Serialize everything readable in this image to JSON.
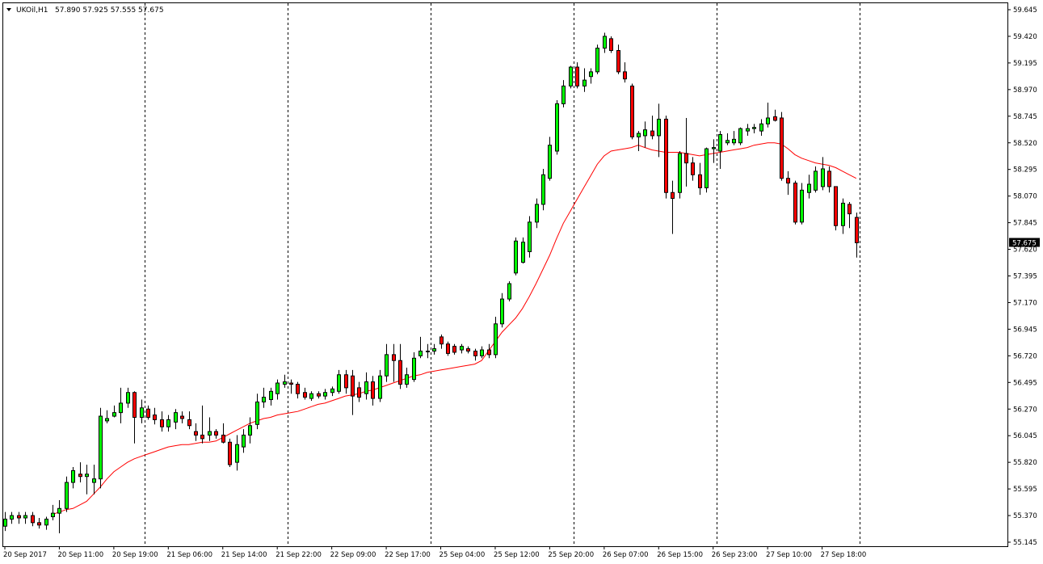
{
  "header": {
    "symbol_label": "UKOil,H1",
    "ohlc_label": "57.890 57.925 57.555 57.675"
  },
  "colors": {
    "background": "#ffffff",
    "bull_candle": "#00ff00",
    "bear_candle": "#ff0000",
    "wick": "#000000",
    "moving_average": "#ff0000",
    "badge_bg": "#000000",
    "badge_text": "#ffffff",
    "grid": "#000000"
  },
  "current_price": {
    "label": "57.675",
    "value": 57.675
  },
  "chart_data": {
    "type": "candlestick",
    "symbol": "UKOil",
    "timeframe": "H1",
    "grid": "vertical dashed separators at x tick positions",
    "ylim": [
      55.145,
      59.645
    ],
    "y_ticks": [
      "59.645",
      "59.420",
      "59.195",
      "58.970",
      "58.745",
      "58.520",
      "58.295",
      "58.070",
      "57.845",
      "57.620",
      "57.395",
      "57.170",
      "56.945",
      "56.720",
      "56.495",
      "56.270",
      "56.045",
      "55.820",
      "55.595",
      "55.370",
      "55.145"
    ],
    "x_ticks": [
      "20 Sep 2017",
      "20 Sep 11:00",
      "20 Sep 19:00",
      "21 Sep 06:00",
      "21 Sep 14:00",
      "21 Sep 22:00",
      "22 Sep 09:00",
      "22 Sep 17:00",
      "25 Sep 04:00",
      "25 Sep 12:00",
      "25 Sep 20:00",
      "26 Sep 07:00",
      "26 Sep 15:00",
      "26 Sep 23:00",
      "27 Sep 10:00",
      "27 Sep 18:00"
    ],
    "x_tick_bar_index": [
      0,
      8,
      16,
      24,
      32,
      40,
      48,
      56,
      64,
      72,
      80,
      88,
      96,
      104,
      112,
      120
    ],
    "separator_bar_index": [
      20.5,
      41.5,
      62.5,
      83.5,
      104.5,
      125.5
    ],
    "candles": [
      {
        "o": 55.28,
        "h": 55.4,
        "l": 55.24,
        "c": 55.34
      },
      {
        "o": 55.34,
        "h": 55.4,
        "l": 55.3,
        "c": 55.37
      },
      {
        "o": 55.37,
        "h": 55.4,
        "l": 55.3,
        "c": 55.35
      },
      {
        "o": 55.35,
        "h": 55.4,
        "l": 55.3,
        "c": 55.37
      },
      {
        "o": 55.37,
        "h": 55.4,
        "l": 55.28,
        "c": 55.31
      },
      {
        "o": 55.31,
        "h": 55.35,
        "l": 55.26,
        "c": 55.29
      },
      {
        "o": 55.29,
        "h": 55.36,
        "l": 55.25,
        "c": 55.34
      },
      {
        "o": 55.36,
        "h": 55.46,
        "l": 55.33,
        "c": 55.39
      },
      {
        "o": 55.39,
        "h": 55.5,
        "l": 55.22,
        "c": 55.43
      },
      {
        "o": 55.43,
        "h": 55.7,
        "l": 55.4,
        "c": 55.65
      },
      {
        "o": 55.65,
        "h": 55.78,
        "l": 55.6,
        "c": 55.75
      },
      {
        "o": 55.72,
        "h": 55.82,
        "l": 55.65,
        "c": 55.7
      },
      {
        "o": 55.7,
        "h": 55.8,
        "l": 55.55,
        "c": 55.72
      },
      {
        "o": 55.65,
        "h": 55.8,
        "l": 55.55,
        "c": 55.68
      },
      {
        "o": 55.68,
        "h": 56.28,
        "l": 55.6,
        "c": 56.21
      },
      {
        "o": 56.17,
        "h": 56.26,
        "l": 56.15,
        "c": 56.19
      },
      {
        "o": 56.21,
        "h": 56.3,
        "l": 56.2,
        "c": 56.24
      },
      {
        "o": 56.24,
        "h": 56.45,
        "l": 56.15,
        "c": 56.32
      },
      {
        "o": 56.32,
        "h": 56.45,
        "l": 56.28,
        "c": 56.41
      },
      {
        "o": 56.41,
        "h": 56.42,
        "l": 55.98,
        "c": 56.2
      },
      {
        "o": 56.2,
        "h": 56.35,
        "l": 56.15,
        "c": 56.28
      },
      {
        "o": 56.27,
        "h": 56.3,
        "l": 56.18,
        "c": 56.2
      },
      {
        "o": 56.22,
        "h": 56.28,
        "l": 56.14,
        "c": 56.18
      },
      {
        "o": 56.18,
        "h": 56.25,
        "l": 56.08,
        "c": 56.12
      },
      {
        "o": 56.12,
        "h": 56.22,
        "l": 56.08,
        "c": 56.18
      },
      {
        "o": 56.16,
        "h": 56.27,
        "l": 56.1,
        "c": 56.24
      },
      {
        "o": 56.21,
        "h": 56.25,
        "l": 56.15,
        "c": 56.19
      },
      {
        "o": 56.18,
        "h": 56.25,
        "l": 56.1,
        "c": 56.13
      },
      {
        "o": 56.08,
        "h": 56.15,
        "l": 56.0,
        "c": 56.05
      },
      {
        "o": 56.05,
        "h": 56.3,
        "l": 55.98,
        "c": 56.02
      },
      {
        "o": 56.05,
        "h": 56.2,
        "l": 56.0,
        "c": 56.08
      },
      {
        "o": 56.08,
        "h": 56.1,
        "l": 56.02,
        "c": 56.05
      },
      {
        "o": 56.05,
        "h": 56.15,
        "l": 55.98,
        "c": 55.99
      },
      {
        "o": 55.99,
        "h": 56.02,
        "l": 55.78,
        "c": 55.8
      },
      {
        "o": 55.82,
        "h": 56.05,
        "l": 55.75,
        "c": 55.97
      },
      {
        "o": 55.95,
        "h": 56.1,
        "l": 55.9,
        "c": 56.05
      },
      {
        "o": 56.05,
        "h": 56.2,
        "l": 55.98,
        "c": 56.13
      },
      {
        "o": 56.14,
        "h": 56.4,
        "l": 56.1,
        "c": 56.33
      },
      {
        "o": 56.33,
        "h": 56.45,
        "l": 56.28,
        "c": 56.37
      },
      {
        "o": 56.35,
        "h": 56.45,
        "l": 56.3,
        "c": 56.42
      },
      {
        "o": 56.4,
        "h": 56.52,
        "l": 56.35,
        "c": 56.49
      },
      {
        "o": 56.48,
        "h": 56.56,
        "l": 56.45,
        "c": 56.5
      },
      {
        "o": 56.49,
        "h": 56.52,
        "l": 56.4,
        "c": 56.48
      },
      {
        "o": 56.48,
        "h": 56.5,
        "l": 56.36,
        "c": 56.4
      },
      {
        "o": 56.41,
        "h": 56.45,
        "l": 56.35,
        "c": 56.37
      },
      {
        "o": 56.36,
        "h": 56.42,
        "l": 56.34,
        "c": 56.4
      },
      {
        "o": 56.4,
        "h": 56.42,
        "l": 56.36,
        "c": 56.38
      },
      {
        "o": 56.38,
        "h": 56.44,
        "l": 56.35,
        "c": 56.41
      },
      {
        "o": 56.41,
        "h": 56.46,
        "l": 56.38,
        "c": 56.44
      },
      {
        "o": 56.42,
        "h": 56.6,
        "l": 56.4,
        "c": 56.56
      },
      {
        "o": 56.56,
        "h": 56.6,
        "l": 56.4,
        "c": 56.45
      },
      {
        "o": 56.55,
        "h": 56.6,
        "l": 56.22,
        "c": 56.38
      },
      {
        "o": 56.45,
        "h": 56.5,
        "l": 56.33,
        "c": 56.37
      },
      {
        "o": 56.4,
        "h": 56.58,
        "l": 56.35,
        "c": 56.5
      },
      {
        "o": 56.5,
        "h": 56.55,
        "l": 56.3,
        "c": 56.36
      },
      {
        "o": 56.36,
        "h": 56.6,
        "l": 56.33,
        "c": 56.55
      },
      {
        "o": 56.55,
        "h": 56.82,
        "l": 56.5,
        "c": 56.73
      },
      {
        "o": 56.73,
        "h": 56.82,
        "l": 56.5,
        "c": 56.68
      },
      {
        "o": 56.68,
        "h": 56.82,
        "l": 56.44,
        "c": 56.48
      },
      {
        "o": 56.48,
        "h": 56.62,
        "l": 56.45,
        "c": 56.56
      },
      {
        "o": 56.52,
        "h": 56.75,
        "l": 56.5,
        "c": 56.7
      },
      {
        "o": 56.72,
        "h": 56.88,
        "l": 56.7,
        "c": 56.76
      },
      {
        "o": 56.76,
        "h": 56.82,
        "l": 56.7,
        "c": 56.76
      },
      {
        "o": 56.76,
        "h": 56.82,
        "l": 56.73,
        "c": 56.78
      },
      {
        "o": 56.88,
        "h": 56.9,
        "l": 56.78,
        "c": 56.82
      },
      {
        "o": 56.82,
        "h": 56.84,
        "l": 56.72,
        "c": 56.74
      },
      {
        "o": 56.8,
        "h": 56.82,
        "l": 56.73,
        "c": 56.75
      },
      {
        "o": 56.77,
        "h": 56.82,
        "l": 56.74,
        "c": 56.8
      },
      {
        "o": 56.78,
        "h": 56.8,
        "l": 56.74,
        "c": 56.76
      },
      {
        "o": 56.76,
        "h": 56.78,
        "l": 56.68,
        "c": 56.72
      },
      {
        "o": 56.72,
        "h": 56.8,
        "l": 56.7,
        "c": 56.77
      },
      {
        "o": 56.77,
        "h": 56.82,
        "l": 56.7,
        "c": 56.73
      },
      {
        "o": 56.73,
        "h": 57.05,
        "l": 56.7,
        "c": 56.99
      },
      {
        "o": 56.99,
        "h": 57.25,
        "l": 56.96,
        "c": 57.2
      },
      {
        "o": 57.2,
        "h": 57.35,
        "l": 57.18,
        "c": 57.33
      },
      {
        "o": 57.42,
        "h": 57.72,
        "l": 57.4,
        "c": 57.69
      },
      {
        "o": 57.51,
        "h": 57.72,
        "l": 57.5,
        "c": 57.68
      },
      {
        "o": 57.6,
        "h": 57.9,
        "l": 57.55,
        "c": 57.85
      },
      {
        "o": 57.85,
        "h": 58.05,
        "l": 57.8,
        "c": 58.0
      },
      {
        "o": 58.0,
        "h": 58.3,
        "l": 57.95,
        "c": 58.25
      },
      {
        "o": 58.22,
        "h": 58.57,
        "l": 58.2,
        "c": 58.5
      },
      {
        "o": 58.45,
        "h": 58.88,
        "l": 58.42,
        "c": 58.85
      },
      {
        "o": 58.85,
        "h": 59.05,
        "l": 58.82,
        "c": 59.0
      },
      {
        "o": 59.0,
        "h": 59.17,
        "l": 58.98,
        "c": 59.16
      },
      {
        "o": 59.16,
        "h": 59.2,
        "l": 58.98,
        "c": 59.0
      },
      {
        "o": 59.0,
        "h": 59.15,
        "l": 58.95,
        "c": 59.05
      },
      {
        "o": 59.08,
        "h": 59.15,
        "l": 59.02,
        "c": 59.12
      },
      {
        "o": 59.12,
        "h": 59.35,
        "l": 59.1,
        "c": 59.32
      },
      {
        "o": 59.32,
        "h": 59.45,
        "l": 59.28,
        "c": 59.42
      },
      {
        "o": 59.4,
        "h": 59.42,
        "l": 59.28,
        "c": 59.3
      },
      {
        "o": 59.3,
        "h": 59.35,
        "l": 59.1,
        "c": 59.12
      },
      {
        "o": 59.12,
        "h": 59.2,
        "l": 59.03,
        "c": 59.06
      },
      {
        "o": 59.0,
        "h": 59.02,
        "l": 58.55,
        "c": 58.57
      },
      {
        "o": 58.57,
        "h": 58.62,
        "l": 58.45,
        "c": 58.6
      },
      {
        "o": 58.58,
        "h": 58.7,
        "l": 58.48,
        "c": 58.63
      },
      {
        "o": 58.62,
        "h": 58.75,
        "l": 58.55,
        "c": 58.58
      },
      {
        "o": 58.58,
        "h": 58.85,
        "l": 58.4,
        "c": 58.72
      },
      {
        "o": 58.72,
        "h": 58.75,
        "l": 58.05,
        "c": 58.1
      },
      {
        "o": 58.1,
        "h": 58.2,
        "l": 57.75,
        "c": 58.05
      },
      {
        "o": 58.1,
        "h": 58.45,
        "l": 58.05,
        "c": 58.43
      },
      {
        "o": 58.43,
        "h": 58.73,
        "l": 58.15,
        "c": 58.35
      },
      {
        "o": 58.35,
        "h": 58.4,
        "l": 58.2,
        "c": 58.25
      },
      {
        "o": 58.25,
        "h": 58.35,
        "l": 58.08,
        "c": 58.14
      },
      {
        "o": 58.14,
        "h": 58.48,
        "l": 58.1,
        "c": 58.47
      },
      {
        "o": 58.47,
        "h": 58.55,
        "l": 58.35,
        "c": 58.48
      },
      {
        "o": 58.45,
        "h": 58.62,
        "l": 58.3,
        "c": 58.59
      },
      {
        "o": 58.52,
        "h": 58.6,
        "l": 58.5,
        "c": 58.54
      },
      {
        "o": 58.52,
        "h": 58.62,
        "l": 58.5,
        "c": 58.55
      },
      {
        "o": 58.52,
        "h": 58.65,
        "l": 58.5,
        "c": 58.64
      },
      {
        "o": 58.62,
        "h": 58.68,
        "l": 58.58,
        "c": 58.64
      },
      {
        "o": 58.64,
        "h": 58.68,
        "l": 58.6,
        "c": 58.65
      },
      {
        "o": 58.62,
        "h": 58.72,
        "l": 58.58,
        "c": 58.68
      },
      {
        "o": 58.68,
        "h": 58.86,
        "l": 58.65,
        "c": 58.73
      },
      {
        "o": 58.74,
        "h": 58.8,
        "l": 58.7,
        "c": 58.71
      },
      {
        "o": 58.73,
        "h": 58.78,
        "l": 58.2,
        "c": 58.22
      },
      {
        "o": 58.22,
        "h": 58.28,
        "l": 58.08,
        "c": 58.18
      },
      {
        "o": 58.18,
        "h": 58.2,
        "l": 57.83,
        "c": 57.85
      },
      {
        "o": 57.85,
        "h": 58.18,
        "l": 57.83,
        "c": 58.12
      },
      {
        "o": 58.1,
        "h": 58.25,
        "l": 58.05,
        "c": 58.17
      },
      {
        "o": 58.12,
        "h": 58.32,
        "l": 58.1,
        "c": 58.28
      },
      {
        "o": 58.15,
        "h": 58.4,
        "l": 58.12,
        "c": 58.3
      },
      {
        "o": 58.28,
        "h": 58.32,
        "l": 58.1,
        "c": 58.15
      },
      {
        "o": 58.15,
        "h": 58.15,
        "l": 57.78,
        "c": 57.82
      },
      {
        "o": 57.82,
        "h": 58.05,
        "l": 57.75,
        "c": 58.01
      },
      {
        "o": 58.0,
        "h": 58.02,
        "l": 57.8,
        "c": 57.92
      },
      {
        "o": 57.89,
        "h": 57.93,
        "l": 57.55,
        "c": 57.675
      }
    ],
    "moving_average": {
      "start_index": 7,
      "values": [
        55.38,
        55.4,
        55.42,
        55.43,
        55.46,
        55.49,
        55.55,
        55.61,
        55.68,
        55.74,
        55.78,
        55.82,
        55.85,
        55.87,
        55.89,
        55.91,
        55.93,
        55.95,
        55.96,
        55.97,
        55.97,
        55.98,
        55.99,
        55.99,
        56.0,
        56.03,
        56.06,
        56.09,
        56.12,
        56.15,
        56.17,
        56.19,
        56.2,
        56.22,
        56.23,
        56.24,
        56.25,
        56.27,
        56.29,
        56.31,
        56.32,
        56.34,
        56.36,
        56.38,
        56.39,
        56.4,
        56.42,
        56.43,
        56.45,
        56.47,
        56.49,
        56.51,
        56.53,
        56.55,
        56.56,
        56.58,
        56.59,
        56.6,
        56.61,
        56.62,
        56.63,
        56.64,
        56.65,
        56.68,
        56.76,
        56.84,
        56.92,
        56.98,
        57.04,
        57.12,
        57.22,
        57.33,
        57.45,
        57.57,
        57.71,
        57.84,
        57.94,
        58.04,
        58.14,
        58.24,
        58.34,
        58.41,
        58.45,
        58.46,
        58.47,
        58.48,
        58.5,
        58.48,
        58.46,
        58.45,
        58.44,
        58.44,
        58.44,
        58.43,
        58.42,
        58.41,
        58.42,
        58.43,
        58.44,
        58.45,
        58.46,
        58.47,
        58.48,
        58.5,
        58.51,
        58.52,
        58.52,
        58.51,
        58.47,
        58.42,
        58.39,
        58.37,
        58.35,
        58.34,
        58.33,
        58.31,
        58.28,
        58.25,
        58.22
      ]
    }
  }
}
